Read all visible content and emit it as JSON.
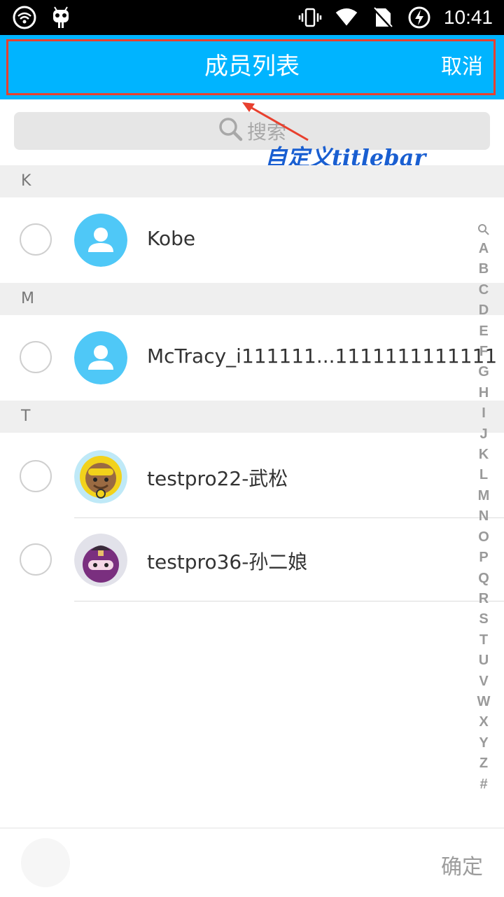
{
  "status_bar": {
    "time": "10:41",
    "icons_left": [
      "wifi-icon",
      "android-notification-icon"
    ],
    "icons_right": [
      "vibrate-icon",
      "signal-icon",
      "no-sim-icon",
      "battery-charging-icon"
    ]
  },
  "title_bar": {
    "title": "成员列表",
    "cancel_label": "取消",
    "background_color": "#00b4ff",
    "highlight_color": "#e8402e"
  },
  "search": {
    "placeholder": "搜索"
  },
  "annotation": {
    "text": "自定义titlebar"
  },
  "sections": [
    {
      "letter": "K",
      "members": [
        {
          "name": "Kobe",
          "avatar": "default-avatar"
        }
      ]
    },
    {
      "letter": "M",
      "members": [
        {
          "name": "McTracy_i111111...1111111111111",
          "avatar": "default-avatar"
        }
      ]
    },
    {
      "letter": "T",
      "members": [
        {
          "name": "testpro22-武松",
          "avatar": "diver-avatar"
        },
        {
          "name": "testpro36-孙二娘",
          "avatar": "ninja-avatar"
        }
      ]
    }
  ],
  "index_letters": [
    "A",
    "B",
    "C",
    "D",
    "E",
    "F",
    "G",
    "H",
    "I",
    "J",
    "K",
    "L",
    "M",
    "N",
    "O",
    "P",
    "Q",
    "R",
    "S",
    "T",
    "U",
    "V",
    "W",
    "X",
    "Y",
    "Z",
    "#"
  ],
  "bottom_bar": {
    "confirm_label": "确定"
  }
}
